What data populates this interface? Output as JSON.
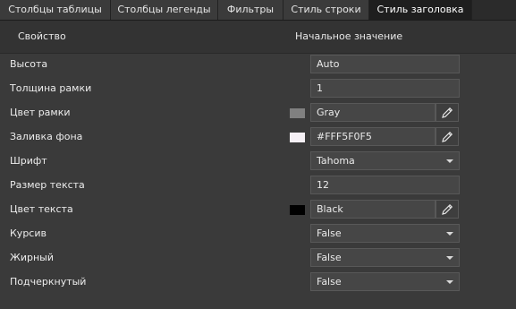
{
  "tabs": [
    {
      "label": "Столбцы таблицы"
    },
    {
      "label": "Столбцы легенды"
    },
    {
      "label": "Фильтры"
    },
    {
      "label": "Стиль строки"
    },
    {
      "label": "Стиль заголовка",
      "active": true
    }
  ],
  "header": {
    "property": "Свойство",
    "initial_value": "Начальное значение"
  },
  "rows": [
    {
      "label": "Высота",
      "value": "Auto",
      "type": "text"
    },
    {
      "label": "Толщина рамки",
      "value": "1",
      "type": "text"
    },
    {
      "label": "Цвет рамки",
      "value": "Gray",
      "type": "color",
      "color": "#808080"
    },
    {
      "label": "Заливка фона",
      "value": "#FFF5F0F5",
      "type": "color",
      "color": "#F5F0F5"
    },
    {
      "label": "Шрифт",
      "value": "Tahoma",
      "type": "select"
    },
    {
      "label": "Размер текста",
      "value": "12",
      "type": "text"
    },
    {
      "label": "Цвет текста",
      "value": "Black",
      "type": "color",
      "color": "#000000"
    },
    {
      "label": "Курсив",
      "value": "False",
      "type": "select"
    },
    {
      "label": "Жирный",
      "value": "False",
      "type": "select"
    },
    {
      "label": "Подчеркнутый",
      "value": "False",
      "type": "select"
    }
  ],
  "icons": {
    "picker": "pencil-icon",
    "dropdown": "chevron-down-icon"
  },
  "colors": {
    "background": "#3a3a3a",
    "tab_active": "#1e1e1e",
    "field": "#464646"
  }
}
